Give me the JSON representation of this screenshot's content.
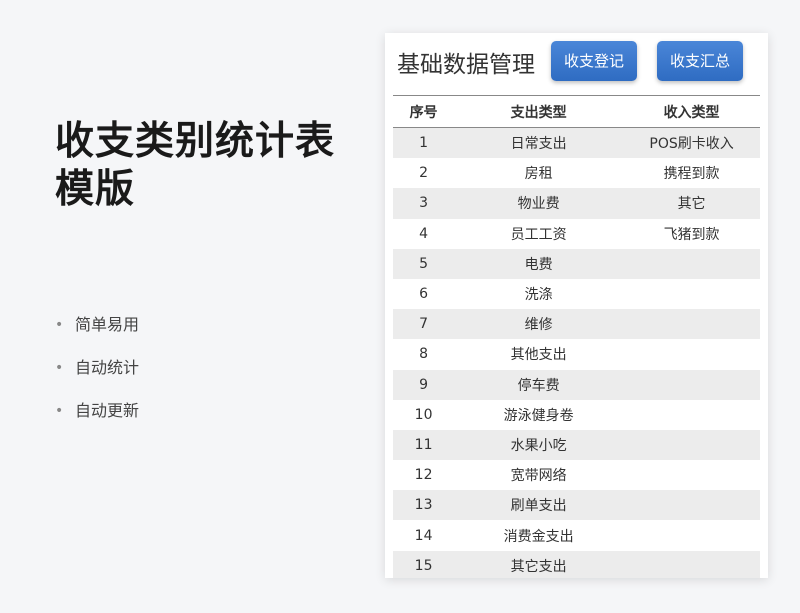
{
  "slide": {
    "title_line1": "收支类别统计表",
    "title_line2": "模版",
    "bullets": [
      "简单易用",
      "自动统计",
      "自动更新"
    ]
  },
  "panel": {
    "title": "基础数据管理",
    "buttons": [
      "收支登记",
      "收支汇总"
    ],
    "columns": [
      "序号",
      "支出类型",
      "收入类型"
    ],
    "rows": [
      [
        "1",
        "日常支出",
        "POS刷卡收入"
      ],
      [
        "2",
        "房租",
        "携程到款"
      ],
      [
        "3",
        "物业费",
        "其它"
      ],
      [
        "4",
        "员工工资",
        "飞猪到款"
      ],
      [
        "5",
        "电费",
        ""
      ],
      [
        "6",
        "洗涤",
        ""
      ],
      [
        "7",
        "维修",
        ""
      ],
      [
        "8",
        "其他支出",
        ""
      ],
      [
        "9",
        "停车费",
        ""
      ],
      [
        "10",
        "游泳健身卷",
        ""
      ],
      [
        "11",
        "水果小吃",
        ""
      ],
      [
        "12",
        "宽带网络",
        ""
      ],
      [
        "13",
        "刷单支出",
        ""
      ],
      [
        "14",
        "消费金支出",
        ""
      ],
      [
        "15",
        "其它支出",
        ""
      ]
    ]
  }
}
